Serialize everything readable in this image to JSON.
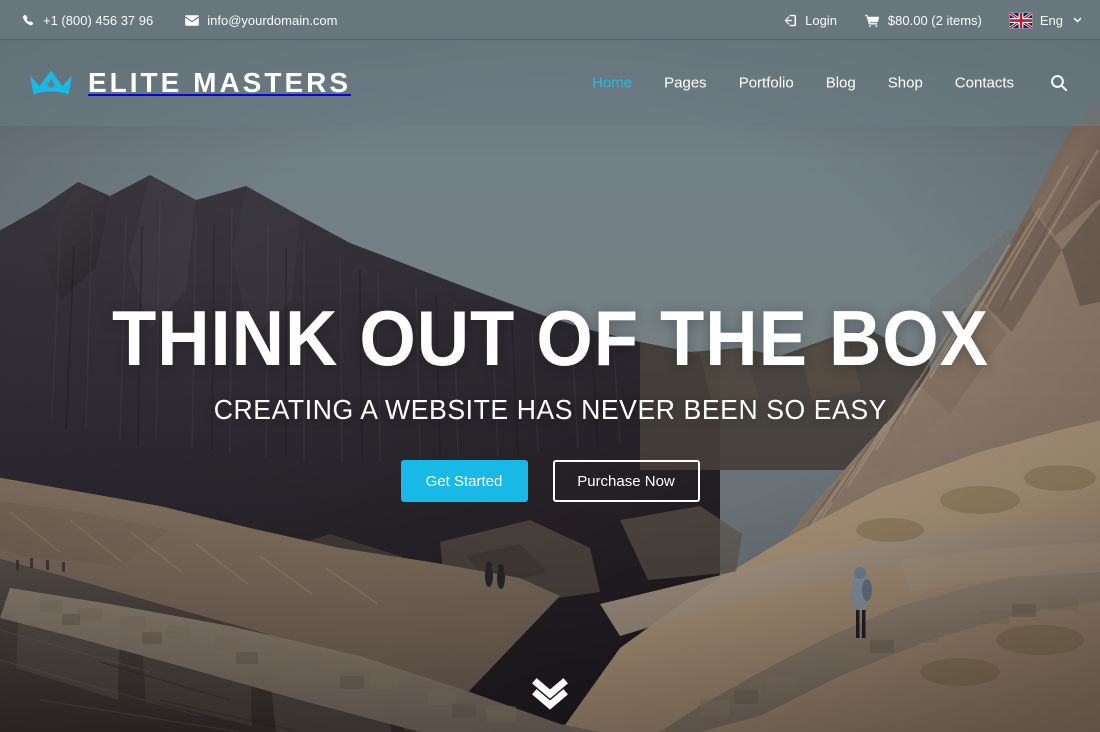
{
  "topbar": {
    "phone": "+1 (800) 456 37 96",
    "phone_icon": "phone-icon",
    "email": "info@yourdomain.com",
    "email_icon": "envelope-icon",
    "login": "Login",
    "login_icon": "sign-in-icon",
    "cart": "$80.00 (2 items)",
    "cart_icon": "shopping-cart-icon",
    "language": "Eng",
    "language_flag": "uk-flag-icon",
    "language_caret": "chevron-down-icon",
    "background_color": "#68777e"
  },
  "header": {
    "logo_text": "ELITE MASTERS",
    "logo_icon": "crown-icon",
    "logo_color": "#18b9e7",
    "search_icon": "search-icon",
    "nav": [
      {
        "label": "Home",
        "active": true
      },
      {
        "label": "Pages",
        "active": false
      },
      {
        "label": "Portfolio",
        "active": false
      },
      {
        "label": "Blog",
        "active": false
      },
      {
        "label": "Shop",
        "active": false
      },
      {
        "label": "Contacts",
        "active": false
      }
    ]
  },
  "hero": {
    "title": "THINK OUT OF THE BOX",
    "subtitle": "CREATING A WEBSITE HAS NEVER BEEN SO EASY",
    "primary_button": "Get Started",
    "secondary_button": "Purchase Now",
    "accent_color": "#18b9e7",
    "scroll_icon": "double-chevron-down-icon",
    "background_image": "mountain-valley-lake-landscape"
  }
}
